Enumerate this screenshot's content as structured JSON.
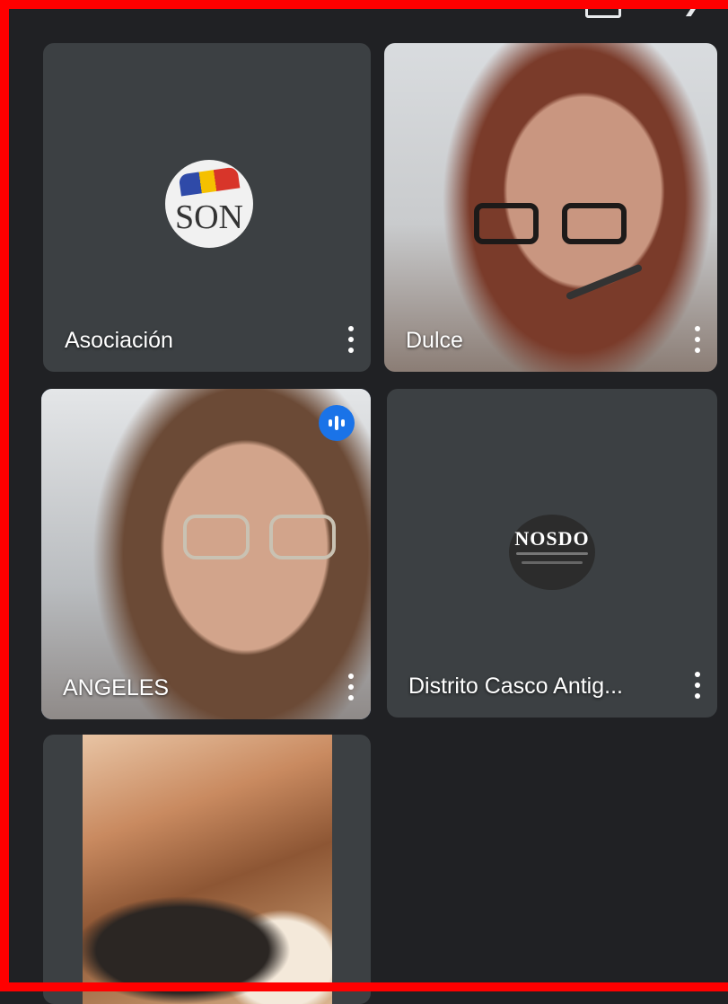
{
  "participants": [
    {
      "name": "Asociación",
      "avatar_text": "SON",
      "type": "avatar"
    },
    {
      "name": "Dulce",
      "type": "video"
    },
    {
      "name": "ANGELES",
      "type": "video",
      "speaking": true
    },
    {
      "name": "Distrito Casco Antig...",
      "avatar_text": "NOSDO",
      "type": "avatar"
    },
    {
      "name": "",
      "type": "video"
    }
  ],
  "colors": {
    "background": "#202124",
    "tile": "#3c4043",
    "active_speaker_border": "#8ab4f8",
    "speaking_badge": "#1a73e8",
    "screenshot_frame": "#ff0000"
  },
  "icons": {
    "more_options": "more-vert-icon",
    "speaking": "audio-level-icon",
    "screen_share": "screen-icon",
    "audio_output": "speaker-icon"
  }
}
